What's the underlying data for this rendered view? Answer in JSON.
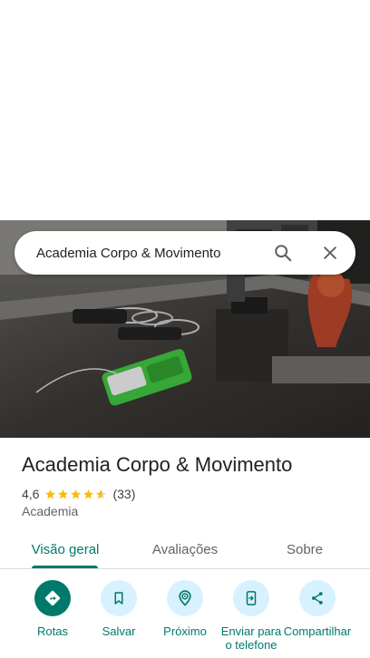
{
  "search": {
    "query": "Academia Corpo & Movimento",
    "search_icon": "search-icon",
    "close_icon": "close-icon"
  },
  "place": {
    "title": "Academia Corpo & Movimento",
    "rating": "4,6",
    "rating_value": 4.6,
    "rating_max": 5,
    "review_count": "(33)",
    "category": "Academia"
  },
  "tabs": [
    {
      "label": "Visão geral",
      "active": true
    },
    {
      "label": "Avaliações",
      "active": false
    },
    {
      "label": "Sobre",
      "active": false
    }
  ],
  "actions": [
    {
      "label": "Rotas",
      "icon": "directions-icon"
    },
    {
      "label": "Salvar",
      "icon": "bookmark-icon"
    },
    {
      "label": "Próximo",
      "icon": "nearby-icon"
    },
    {
      "label": "Enviar para o telefone",
      "icon": "send-to-phone-icon"
    },
    {
      "label": "Compartilhar",
      "icon": "share-icon"
    }
  ],
  "colors": {
    "accent": "#00796b",
    "action_circle": "#d8f1ff",
    "star": "#fbbc04"
  }
}
